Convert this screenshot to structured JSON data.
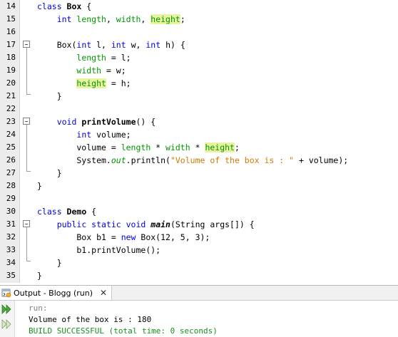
{
  "editor": {
    "lines": [
      {
        "no": "14",
        "tokens": [
          {
            "t": "class ",
            "c": "keyword"
          },
          {
            "t": "Box",
            "c": "name"
          },
          {
            "t": " {",
            "c": "plain"
          }
        ]
      },
      {
        "no": "15",
        "tokens": [
          {
            "t": "    int ",
            "c": "keyword"
          },
          {
            "t": "length",
            "c": "field"
          },
          {
            "t": ", ",
            "c": "plain"
          },
          {
            "t": "width",
            "c": "field"
          },
          {
            "t": ", ",
            "c": "plain"
          },
          {
            "t": "height",
            "c": "field-hl"
          },
          {
            "t": ";",
            "c": "plain"
          }
        ]
      },
      {
        "no": "16",
        "tokens": []
      },
      {
        "no": "17",
        "tokens": [
          {
            "t": "    Box(",
            "c": "plain"
          },
          {
            "t": "int",
            "c": "keyword"
          },
          {
            "t": " l, ",
            "c": "plain"
          },
          {
            "t": "int",
            "c": "keyword"
          },
          {
            "t": " w, ",
            "c": "plain"
          },
          {
            "t": "int",
            "c": "keyword"
          },
          {
            "t": " h) {",
            "c": "plain"
          }
        ]
      },
      {
        "no": "18",
        "tokens": [
          {
            "t": "        ",
            "c": "plain"
          },
          {
            "t": "length",
            "c": "field"
          },
          {
            "t": " = l;",
            "c": "plain"
          }
        ]
      },
      {
        "no": "19",
        "tokens": [
          {
            "t": "        ",
            "c": "plain"
          },
          {
            "t": "width",
            "c": "field"
          },
          {
            "t": " = w;",
            "c": "plain"
          }
        ]
      },
      {
        "no": "20",
        "tokens": [
          {
            "t": "        ",
            "c": "plain"
          },
          {
            "t": "height",
            "c": "field-hl"
          },
          {
            "t": " = h;",
            "c": "plain"
          }
        ]
      },
      {
        "no": "21",
        "tokens": [
          {
            "t": "    }",
            "c": "plain"
          }
        ]
      },
      {
        "no": "22",
        "tokens": []
      },
      {
        "no": "23",
        "tokens": [
          {
            "t": "    ",
            "c": "plain"
          },
          {
            "t": "void ",
            "c": "keyword"
          },
          {
            "t": "printVolume",
            "c": "name"
          },
          {
            "t": "() {",
            "c": "plain"
          }
        ]
      },
      {
        "no": "24",
        "tokens": [
          {
            "t": "        ",
            "c": "plain"
          },
          {
            "t": "int",
            "c": "keyword"
          },
          {
            "t": " volume;",
            "c": "plain"
          }
        ]
      },
      {
        "no": "25",
        "tokens": [
          {
            "t": "        volume = ",
            "c": "plain"
          },
          {
            "t": "length",
            "c": "field"
          },
          {
            "t": " * ",
            "c": "plain"
          },
          {
            "t": "width",
            "c": "field"
          },
          {
            "t": " * ",
            "c": "plain"
          },
          {
            "t": "height",
            "c": "field-hl"
          },
          {
            "t": ";",
            "c": "plain"
          }
        ]
      },
      {
        "no": "26",
        "tokens": [
          {
            "t": "        System.",
            "c": "plain"
          },
          {
            "t": "out",
            "c": "static"
          },
          {
            "t": ".println(",
            "c": "plain"
          },
          {
            "t": "\"Volume of the box is : \"",
            "c": "string"
          },
          {
            "t": " + volume);",
            "c": "plain"
          }
        ]
      },
      {
        "no": "27",
        "tokens": [
          {
            "t": "    }",
            "c": "plain"
          }
        ]
      },
      {
        "no": "28",
        "tokens": [
          {
            "t": "}",
            "c": "plain"
          }
        ]
      },
      {
        "no": "29",
        "tokens": []
      },
      {
        "no": "30",
        "tokens": [
          {
            "t": "class ",
            "c": "keyword"
          },
          {
            "t": "Demo",
            "c": "name"
          },
          {
            "t": " {",
            "c": "plain"
          }
        ]
      },
      {
        "no": "31",
        "tokens": [
          {
            "t": "    ",
            "c": "plain"
          },
          {
            "t": "public static void ",
            "c": "keyword"
          },
          {
            "t": "main",
            "c": "italic"
          },
          {
            "t": "(String args[]) {",
            "c": "plain"
          }
        ]
      },
      {
        "no": "32",
        "tokens": [
          {
            "t": "        Box b1 = ",
            "c": "plain"
          },
          {
            "t": "new",
            "c": "keyword"
          },
          {
            "t": " Box(12, 5, 3);",
            "c": "plain"
          }
        ]
      },
      {
        "no": "33",
        "tokens": [
          {
            "t": "        b1.printVolume();",
            "c": "plain"
          }
        ]
      },
      {
        "no": "34",
        "tokens": [
          {
            "t": "    }",
            "c": "plain"
          }
        ]
      },
      {
        "no": "35",
        "tokens": [
          {
            "t": "}",
            "c": "plain"
          }
        ]
      }
    ]
  },
  "output": {
    "tab_label": "Output - Blogg (run)",
    "tab_icon": "console-icon",
    "close_symbol": "✕",
    "lines": [
      {
        "text": "run:",
        "style": "grey"
      },
      {
        "text": "Volume of the box is : 180",
        "style": "black"
      },
      {
        "text": "BUILD SUCCESSFUL (total time: 0 seconds)",
        "style": "green"
      }
    ]
  },
  "colors": {
    "keyword": "#0000e6",
    "field": "#009900",
    "field_highlight_bg": "#e8f2a1",
    "string": "#ce7b00",
    "build_success": "#1a8f1a",
    "run_arrow": "#3a9a2a"
  }
}
